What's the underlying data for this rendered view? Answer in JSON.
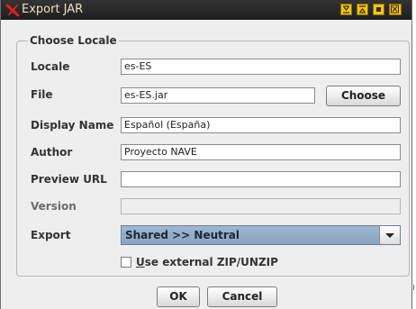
{
  "window": {
    "title": "Export JAR"
  },
  "section": {
    "legend": "Choose Locale"
  },
  "form": {
    "locale": {
      "label": "Locale",
      "value": "es-ES"
    },
    "file": {
      "label": "File",
      "value": "es-ES.jar",
      "button_label": "Choose"
    },
    "display_name": {
      "label": "Display Name",
      "value": "Español (España)"
    },
    "author": {
      "label": "Author",
      "value": "Proyecto NAVE"
    },
    "preview_url": {
      "label": "Preview URL",
      "value": ""
    },
    "version": {
      "label": "Version",
      "value": ""
    },
    "export": {
      "label": "Export",
      "selected": "Shared >> Neutral"
    },
    "external_zip": {
      "label_mnemonic": "U",
      "label_rest": "se external ZIP/UNZIP",
      "checked": false
    }
  },
  "buttons": {
    "ok": "OK",
    "cancel": "Cancel"
  },
  "icons": {
    "app": "red-x-icon",
    "window_controls": [
      "minimize-icon",
      "maximize-icon",
      "restore-icon",
      "close-icon"
    ]
  },
  "colors": {
    "titlebar": "#262626",
    "title_text": "#e8e0c0",
    "window_button": "#f1c40f",
    "combo_selected": "#96aeca",
    "dialog_bg": "#eeeeee"
  }
}
